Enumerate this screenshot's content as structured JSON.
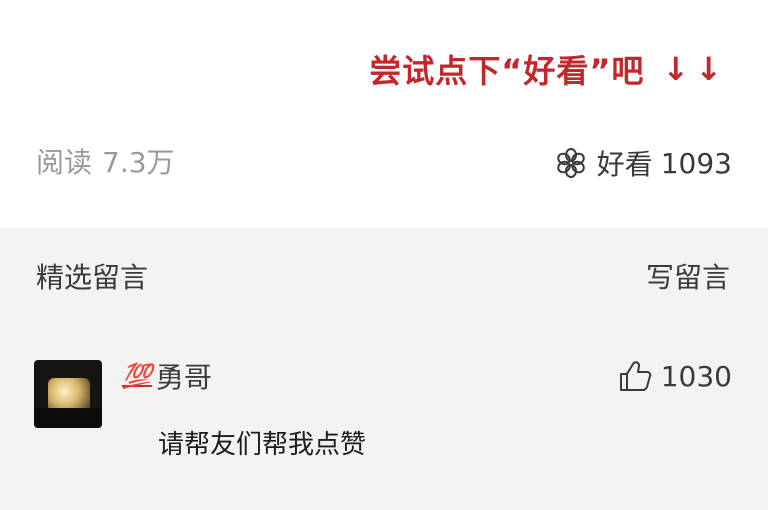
{
  "top": {
    "hint_text": "尝试点下“好看”吧",
    "hint_arrows": "↓↓",
    "hint_color": "#c3272b"
  },
  "stats": {
    "read_label": "阅读",
    "read_count": "7.3万",
    "wow_icon": "flower-icon",
    "wow_label": "好看",
    "wow_count": "1093"
  },
  "comments": {
    "title": "精选留言",
    "write_label": "写留言",
    "items": [
      {
        "user_emoji": "💯",
        "user_name": "勇哥",
        "like_icon": "thumbs-up-icon",
        "like_count": "1030",
        "text": "请帮友们帮我点赞"
      }
    ]
  }
}
